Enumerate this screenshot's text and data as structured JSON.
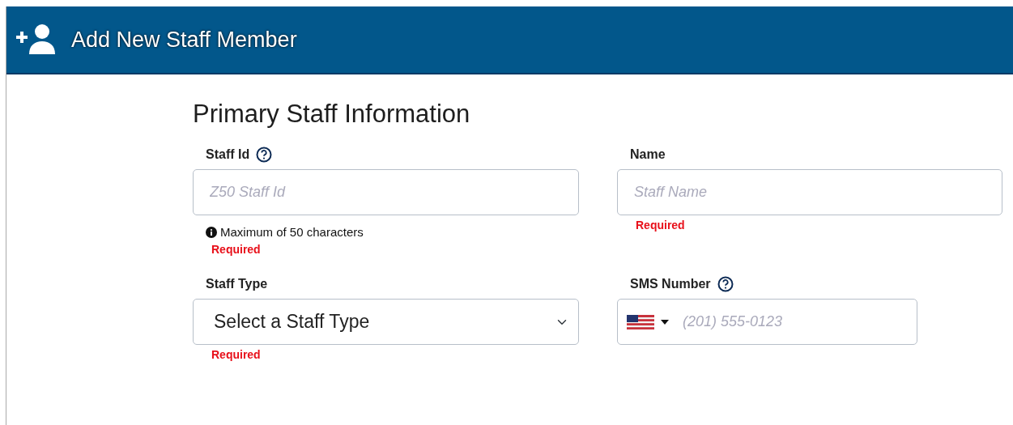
{
  "header": {
    "title": "Add New Staff Member"
  },
  "section_title": "Primary Staff Information",
  "fields": [
    {
      "kind": "text",
      "label": "Staff Id",
      "help": true,
      "placeholder": "Z50 Staff Id",
      "hint": "Maximum of 50 characters",
      "error": "Required"
    },
    {
      "kind": "text",
      "label": "Name",
      "help": false,
      "placeholder": "Staff Name",
      "error": "Required"
    },
    {
      "kind": "select",
      "label": "Staff Type",
      "help": false,
      "value": "Select a Staff Type",
      "error": "Required"
    },
    {
      "kind": "phone",
      "label": "SMS Number",
      "help": true,
      "placeholder": "(201) 555-0123"
    }
  ]
}
